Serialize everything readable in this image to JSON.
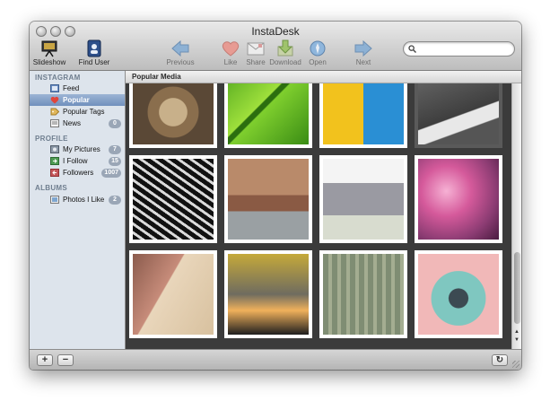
{
  "window": {
    "title": "InstaDesk"
  },
  "toolbar": {
    "slideshow": "Slideshow",
    "find_user": "Find User",
    "previous": "Previous",
    "like": "Like",
    "share": "Share",
    "download": "Download",
    "open": "Open",
    "next": "Next",
    "search_placeholder": ""
  },
  "sidebar": {
    "instagram_header": "INSTAGRAM",
    "profile_header": "PROFILE",
    "albums_header": "ALBUMS",
    "items": [
      {
        "label": "Feed",
        "icon": "feed-icon"
      },
      {
        "label": "Popular",
        "icon": "heart-icon"
      },
      {
        "label": "Popular Tags",
        "icon": "tag-icon"
      },
      {
        "label": "News",
        "icon": "news-icon",
        "badge": "0"
      },
      {
        "label": "My Pictures",
        "icon": "pictures-icon",
        "badge": "7"
      },
      {
        "label": "I Follow",
        "icon": "follow-icon",
        "badge": "15"
      },
      {
        "label": "Followers",
        "icon": "followers-icon",
        "badge": "1007"
      },
      {
        "label": "Photos I Like",
        "icon": "album-icon",
        "badge": "2"
      }
    ]
  },
  "content": {
    "header": "Popular Media",
    "photos": [
      {
        "name": "kitten"
      },
      {
        "name": "green-grass-path"
      },
      {
        "name": "umbrella-collage"
      },
      {
        "name": "ice-cream-cone"
      },
      {
        "name": "wave-pattern-bw"
      },
      {
        "name": "venice-canal"
      },
      {
        "name": "japanese-castle"
      },
      {
        "name": "cherry-blossoms"
      },
      {
        "name": "romeo-juliet-book"
      },
      {
        "name": "sunset-sky"
      },
      {
        "name": "green-shutters"
      },
      {
        "name": "retro-camera"
      }
    ]
  },
  "bottombar": {
    "add": "+",
    "remove": "−",
    "refresh": "↻"
  },
  "colors": {
    "selection": "#7a97c3",
    "sidebar_bg": "#dde4ec",
    "grid_bg": "#3b3b3b",
    "badge": "#9aa6b6"
  }
}
